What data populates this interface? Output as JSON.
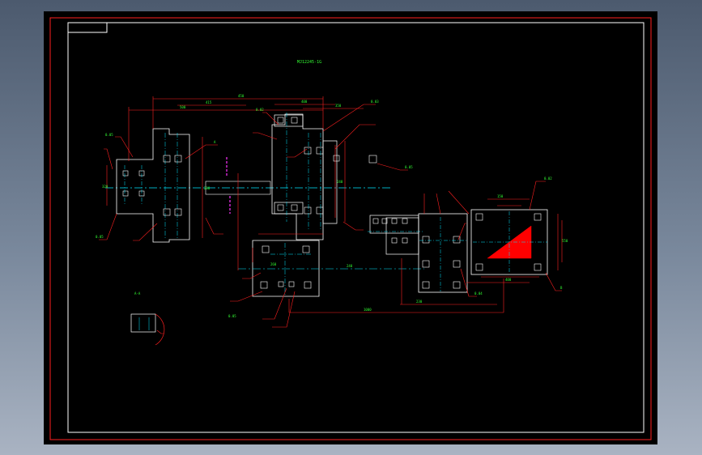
{
  "drawing": {
    "colors": {
      "background": "#000000",
      "border_outer": "#ff2020",
      "frame": "#ffffff",
      "dimension": "#ff2020",
      "centerline": "#00e5ff",
      "text": "#33ff33",
      "magenta": "#ff33ff"
    },
    "title_note": "MJ12245-1G",
    "main_dims": [
      "450",
      "500",
      "415",
      "400",
      "350",
      "320",
      "280",
      "240",
      "260",
      "240",
      "230",
      "1000",
      "150",
      "550",
      "400"
    ],
    "callouts": [
      "0.05",
      "0.05",
      "0.02",
      "0.03",
      "0.05",
      "0.05",
      "0.04",
      "0.02",
      "A",
      "B"
    ],
    "detail_label": "A-A"
  }
}
